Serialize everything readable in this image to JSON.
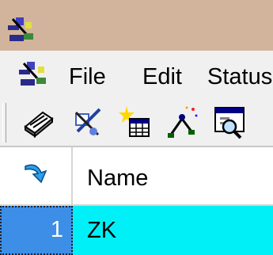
{
  "menu": {
    "file": "File",
    "edit": "Edit",
    "status": "Status"
  },
  "toolbar": {
    "buttons": [
      {
        "icon": "scanner-icon"
      },
      {
        "icon": "edit-tool-icon"
      },
      {
        "icon": "new-table-icon"
      },
      {
        "icon": "wizard-icon"
      },
      {
        "icon": "preview-window-icon"
      }
    ]
  },
  "grid": {
    "columns": [
      "Name"
    ],
    "rows": [
      {
        "num": "1",
        "name": "ZK"
      }
    ]
  },
  "colors": {
    "titlebar": "#d2b49c",
    "selection_cell": "#00f0f8",
    "row_header_selected": "#3c8ee6"
  }
}
